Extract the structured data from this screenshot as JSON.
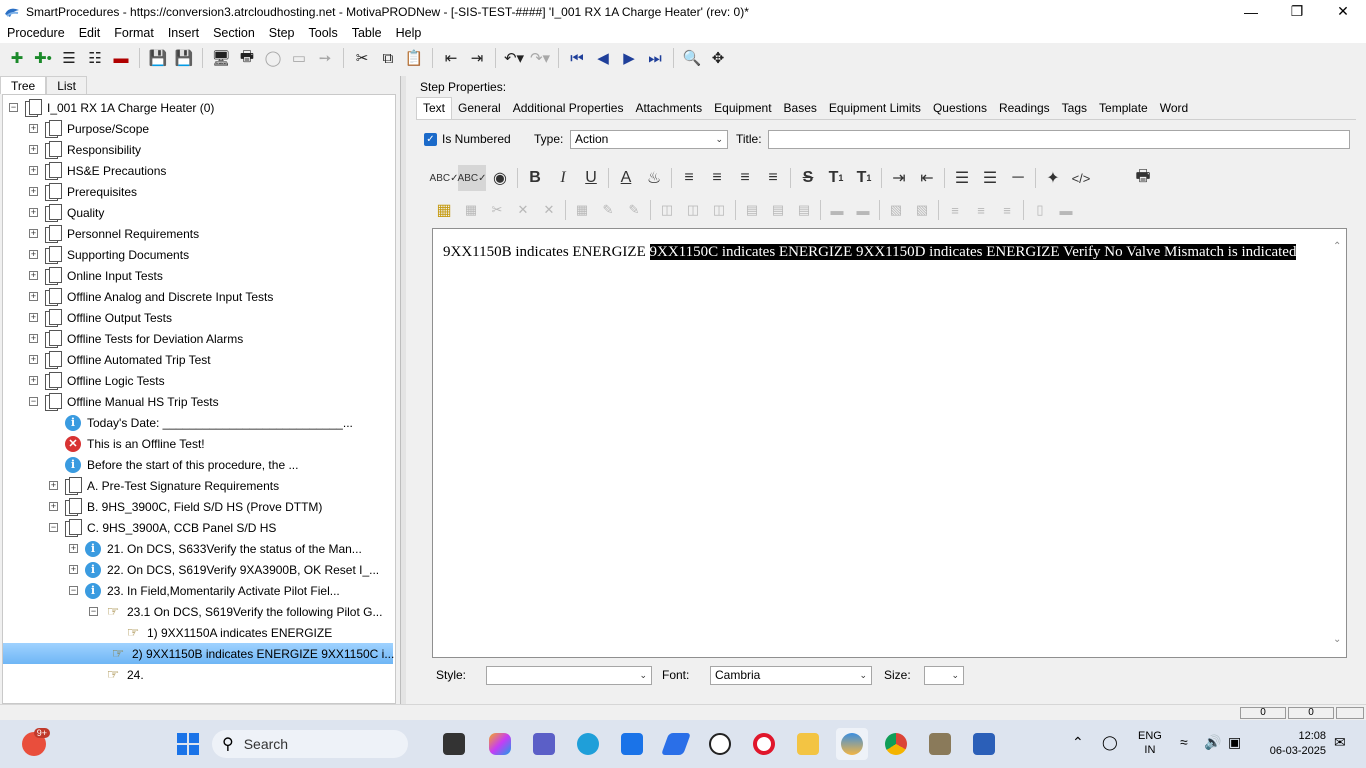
{
  "window": {
    "title": "SmartProcedures - https://conversion3.atrcloudhosting.net - MotivaPRODNew - [-SIS-TEST-####] 'I_001 RX 1A Charge Heater' (rev: 0)*",
    "minimize_icon": "minimize-icon",
    "restore_icon": "restore-icon",
    "close_icon": "close-icon"
  },
  "menu": [
    "Procedure",
    "Edit",
    "Format",
    "Insert",
    "Section",
    "Step",
    "Tools",
    "Table",
    "Help"
  ],
  "left_tabs": [
    "Tree",
    "List"
  ],
  "tree": [
    {
      "label": "I_001 RX 1A Charge Heater (0)",
      "level": 0,
      "icon": "doc",
      "expander": "minus"
    },
    {
      "label": "Purpose/Scope",
      "level": 1,
      "icon": "doc",
      "expander": "plus"
    },
    {
      "label": "Responsibility",
      "level": 1,
      "icon": "doc",
      "expander": "plus"
    },
    {
      "label": "HS&E Precautions",
      "level": 1,
      "icon": "doc",
      "expander": "plus"
    },
    {
      "label": "Prerequisites",
      "level": 1,
      "icon": "doc",
      "expander": "plus"
    },
    {
      "label": "Quality",
      "level": 1,
      "icon": "doc",
      "expander": "plus"
    },
    {
      "label": "Personnel Requirements",
      "level": 1,
      "icon": "doc",
      "expander": "plus"
    },
    {
      "label": "Supporting Documents",
      "level": 1,
      "icon": "doc",
      "expander": "plus"
    },
    {
      "label": "Online Input Tests",
      "level": 1,
      "icon": "doc",
      "expander": "plus"
    },
    {
      "label": "Offline Analog and Discrete Input Tests",
      "level": 1,
      "icon": "doc",
      "expander": "plus"
    },
    {
      "label": "Offline Output Tests",
      "level": 1,
      "icon": "doc",
      "expander": "plus"
    },
    {
      "label": "Offline Tests for Deviation Alarms",
      "level": 1,
      "icon": "doc",
      "expander": "plus"
    },
    {
      "label": "Offline Automated Trip Test",
      "level": 1,
      "icon": "doc",
      "expander": "plus"
    },
    {
      "label": "Offline Logic Tests",
      "level": 1,
      "icon": "doc",
      "expander": "plus"
    },
    {
      "label": "Offline Manual HS Trip Tests",
      "level": 1,
      "icon": "doc",
      "expander": "minus"
    },
    {
      "label": "Today's Date: ___________________________...",
      "level": 2,
      "icon": "info",
      "expander": "none"
    },
    {
      "label": "This is an Offline Test!",
      "level": 2,
      "icon": "error",
      "expander": "none"
    },
    {
      "label": "Before the start of this procedure, the ...",
      "level": 2,
      "icon": "info",
      "expander": "none"
    },
    {
      "label": "A. Pre-Test Signature Requirements",
      "level": 2,
      "icon": "doc",
      "expander": "plus"
    },
    {
      "label": "B. 9HS_3900C, Field S/D HS (Prove DTTM)",
      "level": 2,
      "icon": "doc",
      "expander": "plus"
    },
    {
      "label": "C. 9HS_3900A, CCB Panel S/D HS",
      "level": 2,
      "icon": "doc",
      "expander": "minus"
    },
    {
      "label": "21. On DCS, S633Verify the status of the Man...",
      "level": 3,
      "icon": "info",
      "expander": "plus"
    },
    {
      "label": "22. On DCS, S619Verify 9XA3900B, OK Reset I_...",
      "level": 3,
      "icon": "info",
      "expander": "plus"
    },
    {
      "label": "23. In Field,Momentarily Activate Pilot Fiel...",
      "level": 3,
      "icon": "info",
      "expander": "minus"
    },
    {
      "label": "23.1 On DCS, S619Verify the following Pilot G...",
      "level": 4,
      "icon": "hand",
      "expander": "minus"
    },
    {
      "label": "1) 9XX1150A indicates ENERGIZE",
      "level": 5,
      "icon": "hand",
      "expander": "none"
    },
    {
      "label": "2) 9XX1150B indicates ENERGIZE 9XX1150C i...",
      "level": 5,
      "icon": "hand",
      "expander": "none",
      "selected": true
    },
    {
      "label": "24.",
      "level": 4,
      "icon": "hand",
      "expander": "none"
    }
  ],
  "step_properties": {
    "heading": "Step Properties:",
    "tabs": [
      "Text",
      "General",
      "Additional Properties",
      "Attachments",
      "Equipment",
      "Bases",
      "Equipment Limits",
      "Questions",
      "Readings",
      "Tags",
      "Template",
      "Word"
    ],
    "is_numbered_label": "Is Numbered",
    "type_label": "Type:",
    "type_value": "Action",
    "title_label": "Title:",
    "title_value": "",
    "editor_text_plain": "9XX1150B indicates ENERGIZE ",
    "editor_text_selected": "9XX1150C indicates ENERGIZE 9XX1150D indicates ENERGIZE Verify No Valve Mismatch is indicated",
    "style_label": "Style:",
    "style_value": "",
    "font_label": "Font:",
    "font_value": "Cambria",
    "size_label": "Size:",
    "size_value": ""
  },
  "status": {
    "cell1": "0",
    "cell2": "0"
  },
  "taskbar": {
    "search_label": "Search",
    "notification_badge": "9+",
    "lang_line1": "ENG",
    "lang_line2": "IN",
    "time": "12:08",
    "date": "06-03-2025"
  }
}
